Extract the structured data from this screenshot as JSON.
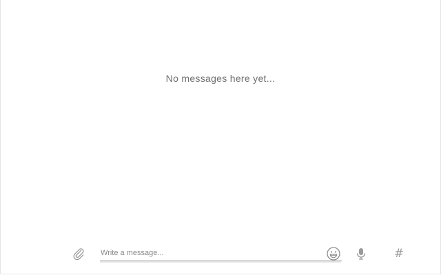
{
  "messages": {
    "empty_text": "No messages here yet..."
  },
  "composer": {
    "placeholder": "Write a message...",
    "hashtag_glyph": "#",
    "icons": {
      "attach": "paperclip-icon",
      "emoji": "smiley-icon",
      "voice": "microphone-icon",
      "hashtag": "hashtag-icon"
    }
  },
  "colors": {
    "text_muted": "#6f6f6f",
    "icon": "#9a9a9a",
    "background": "#ffffff"
  }
}
